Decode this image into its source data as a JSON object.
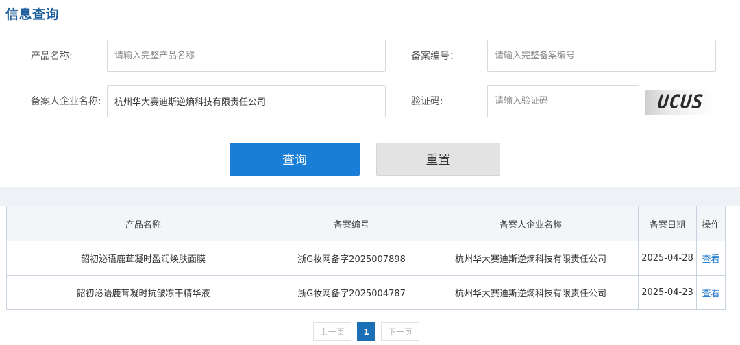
{
  "page": {
    "title": "信息查询"
  },
  "form": {
    "product_name": {
      "label": "产品名称:",
      "value": "",
      "placeholder": "请输入完整产品名称"
    },
    "record_number": {
      "label": "备案编号：",
      "value": "",
      "placeholder": "请输入完整备案编号"
    },
    "company_name": {
      "label": "备案人企业名称:",
      "value": "杭州华大赛迪斯逆熵科技有限责任公司",
      "placeholder": ""
    },
    "captcha": {
      "label": "验证码:",
      "value": "",
      "placeholder": "请输入验证码",
      "image_text": "UCUS"
    }
  },
  "buttons": {
    "query_label": "查询",
    "reset_label": "重置"
  },
  "table": {
    "headers": [
      "产品名称",
      "备案编号",
      "备案人企业名称",
      "备案日期",
      "操作"
    ],
    "rows": [
      {
        "product": "韶初泌语鹿茸凝时盈润焕肤面膜",
        "record_no": "浙G妆网备字2025007898",
        "company": "杭州华大赛迪斯逆熵科技有限责任公司",
        "date": "2025-04-28",
        "action": "查看"
      },
      {
        "product": "韶初泌语鹿茸凝时抗皱冻干精华液",
        "record_no": "浙G妆网备字2025004787",
        "company": "杭州华大赛迪斯逆熵科技有限责任公司",
        "date": "2025-04-23",
        "action": "查看"
      }
    ]
  },
  "pagination": {
    "prev_label": "上一页",
    "current_page": "1",
    "next_label": "下一页"
  },
  "colors": {
    "title": "#1e5f9e",
    "primary_button": "#1a7ed6",
    "link": "#1a73c9",
    "current_page": "#1a6fb5"
  }
}
